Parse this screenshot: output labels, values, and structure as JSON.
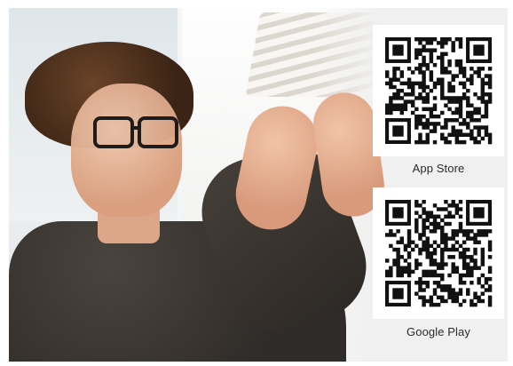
{
  "hero": {
    "image": "person-examining-model-photo"
  },
  "stores": [
    {
      "label": "App Store",
      "qr_icon": "qr-code-icon"
    },
    {
      "label": "Google Play",
      "qr_icon": "qr-code-icon"
    }
  ],
  "colors": {
    "qr_dark": "#111111",
    "qr_light": "#ffffff",
    "caption": "#2b2b2b"
  }
}
